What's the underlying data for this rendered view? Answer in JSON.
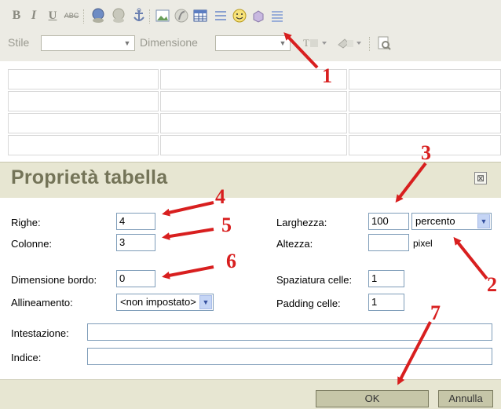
{
  "toolbar": {
    "row1_icons": [
      "bold-icon",
      "italic-icon",
      "underline-icon",
      "spellcheck-icon",
      "link-icon",
      "unlink-icon",
      "anchor-icon",
      "image-icon",
      "flash-icon",
      "table-icon",
      "horizontal-rule-icon",
      "smiley-icon",
      "special-char-icon",
      "page-break-icon"
    ],
    "bold": "B",
    "italic": "I",
    "underline": "U",
    "spell": "ABC",
    "style_label": "Stile",
    "size_label": "Dimensione",
    "dropdown_arrow": "▼"
  },
  "dialog": {
    "title": "Proprietà tabella",
    "close": "⊠",
    "fields": {
      "rows_label": "Righe:",
      "rows_value": "4",
      "cols_label": "Colonne:",
      "cols_value": "3",
      "border_label": "Dimensione bordo:",
      "border_value": "0",
      "align_label": "Allineamento:",
      "align_value": "<non impostato>",
      "width_label": "Larghezza:",
      "width_value": "100",
      "width_unit": "percento",
      "height_label": "Altezza:",
      "height_value": "",
      "height_unit": "pixel",
      "spacing_label": "Spaziatura celle:",
      "spacing_value": "1",
      "padding_label": "Padding celle:",
      "padding_value": "1",
      "caption_label": "Intestazione:",
      "caption_value": "",
      "summary_label": "Indice:",
      "summary_value": ""
    },
    "buttons": {
      "ok": "OK",
      "cancel": "Annulla"
    }
  },
  "annotations": [
    "1",
    "2",
    "3",
    "4",
    "5",
    "6",
    "7"
  ],
  "colors": {
    "annotation": "#d81f1f",
    "header_bg": "#e7e6d2",
    "title_color": "#747458"
  }
}
